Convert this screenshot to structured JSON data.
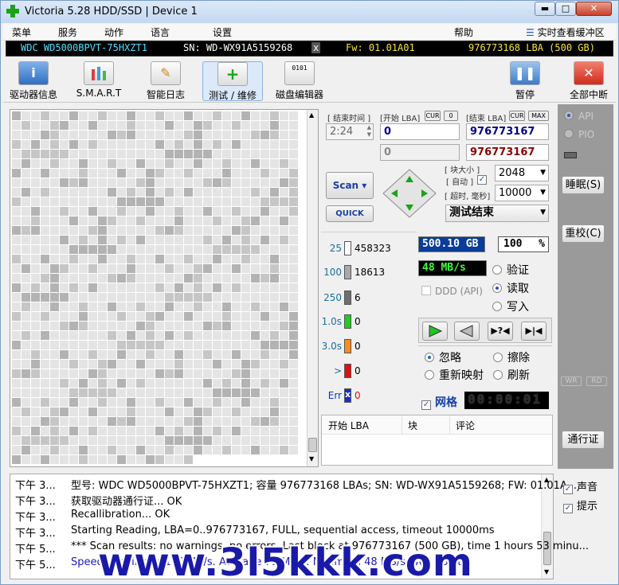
{
  "window": {
    "title": "Victoria 5.28 HDD/SSD | Device 1",
    "min": "▬",
    "max": "□",
    "close": "✕"
  },
  "menu": {
    "items": [
      "菜单",
      "服务",
      "动作",
      "语言",
      "设置"
    ],
    "help": "帮助",
    "realtime": "实时查看缓冲区"
  },
  "infobar": {
    "model": "WDC WD5000BPVT-75HXZT1",
    "sn": "SN: WD-WX91A5159268",
    "x": "x",
    "fw": "Fw: 01.01A01",
    "lba": "976773168 LBA (500 GB)"
  },
  "toolbar": {
    "items": [
      {
        "label": "驱动器信息",
        "icon": "i"
      },
      {
        "label": "S.M.A.R.T",
        "icon": "▮▮"
      },
      {
        "label": "智能日志",
        "icon": "✎"
      },
      {
        "label": "测试 / 维修",
        "icon": "+"
      },
      {
        "label": "磁盘编辑器",
        "icon": "0101"
      }
    ],
    "pause": "暂停",
    "abort": "全部中断"
  },
  "controls": {
    "end_time_label": "[ 结束时间 ]",
    "start_lba_label": "[开始 LBA]",
    "end_lba_label": "[结束 LBA]",
    "cur": "CUR",
    "zero": "0",
    "max": "MAX",
    "time_value": "2:24",
    "start_lba": "0",
    "start_lba2": "0",
    "end_lba": "976773167",
    "end_lba2": "976773167",
    "scan": "Scan ▾",
    "quick": "QUICK",
    "block_size_label": "[ 块大小 ]",
    "auto_label": "[ 自动 ]",
    "timeout_label": "[ 超时, 毫秒]",
    "block_size": "2048",
    "timeout": "10000",
    "status": "测试结束"
  },
  "stats": {
    "rows": [
      {
        "label": "25",
        "value": "458323",
        "color": "#ffffff"
      },
      {
        "label": "100",
        "value": "18613",
        "color": "#a9a9a9"
      },
      {
        "label": "250",
        "value": "6",
        "color": "#6f6f6f"
      },
      {
        "label": "1.0s",
        "value": "0",
        "color": "#1fcc1f"
      },
      {
        "label": "3.0s",
        "value": "0",
        "color": "#ff8c1a"
      },
      {
        "label": ">",
        "value": "0",
        "color": "#e01010"
      },
      {
        "label": "Err",
        "value": "0",
        "color": "#1030d0"
      }
    ],
    "err_mark": "x"
  },
  "readouts": {
    "size": "500.10 GB",
    "percent": "100",
    "percent_unit": "%",
    "speed": "48 MB/s",
    "ddd": "DDD (API)"
  },
  "modes": {
    "verify": "验证",
    "read": "读取",
    "write": "写入"
  },
  "actions": {
    "ignore": "忽略",
    "erase": "擦除",
    "remap": "重新映射",
    "refresh": "刷新"
  },
  "grid": {
    "label": "网格",
    "timer": "00:00:01"
  },
  "table": {
    "col_start": "开始 LBA",
    "col_block": "块",
    "col_comment": "评论"
  },
  "side": {
    "api": "API",
    "pio": "PIO",
    "sleep": "睡眠(S)",
    "recal": "重校(C)",
    "wr": "WR",
    "rd": "RD",
    "passp": "通行证"
  },
  "log": {
    "rows": [
      {
        "time": "下午 3...",
        "msg": "型号: WDC WD5000BPVT-75HXZT1; 容量 976773168 LBAs; SN: WD-WX91A5159268; FW: 01.01A..."
      },
      {
        "time": "下午 3...",
        "msg": "获取驱动器通行证... OK"
      },
      {
        "time": "下午 3...",
        "msg": "Recallibration... OK"
      },
      {
        "time": "下午 3...",
        "msg": "Starting Reading, LBA=0..976773167, FULL, sequential access, timeout 10000ms"
      },
      {
        "time": "下午 5...",
        "msg": "*** Scan results: no warnings, no errors. Last block at 976773167 (500 GB), time 1 hours 53 minu..."
      },
      {
        "time": "下午 5...",
        "msg": "Speed: Maximum 100 MB/s. Average 71 MB/s. Minimum 48 MB/s. 409 points."
      }
    ],
    "sound": "声音",
    "hints": "提示"
  },
  "watermark": "www.3l5kkk.com"
}
